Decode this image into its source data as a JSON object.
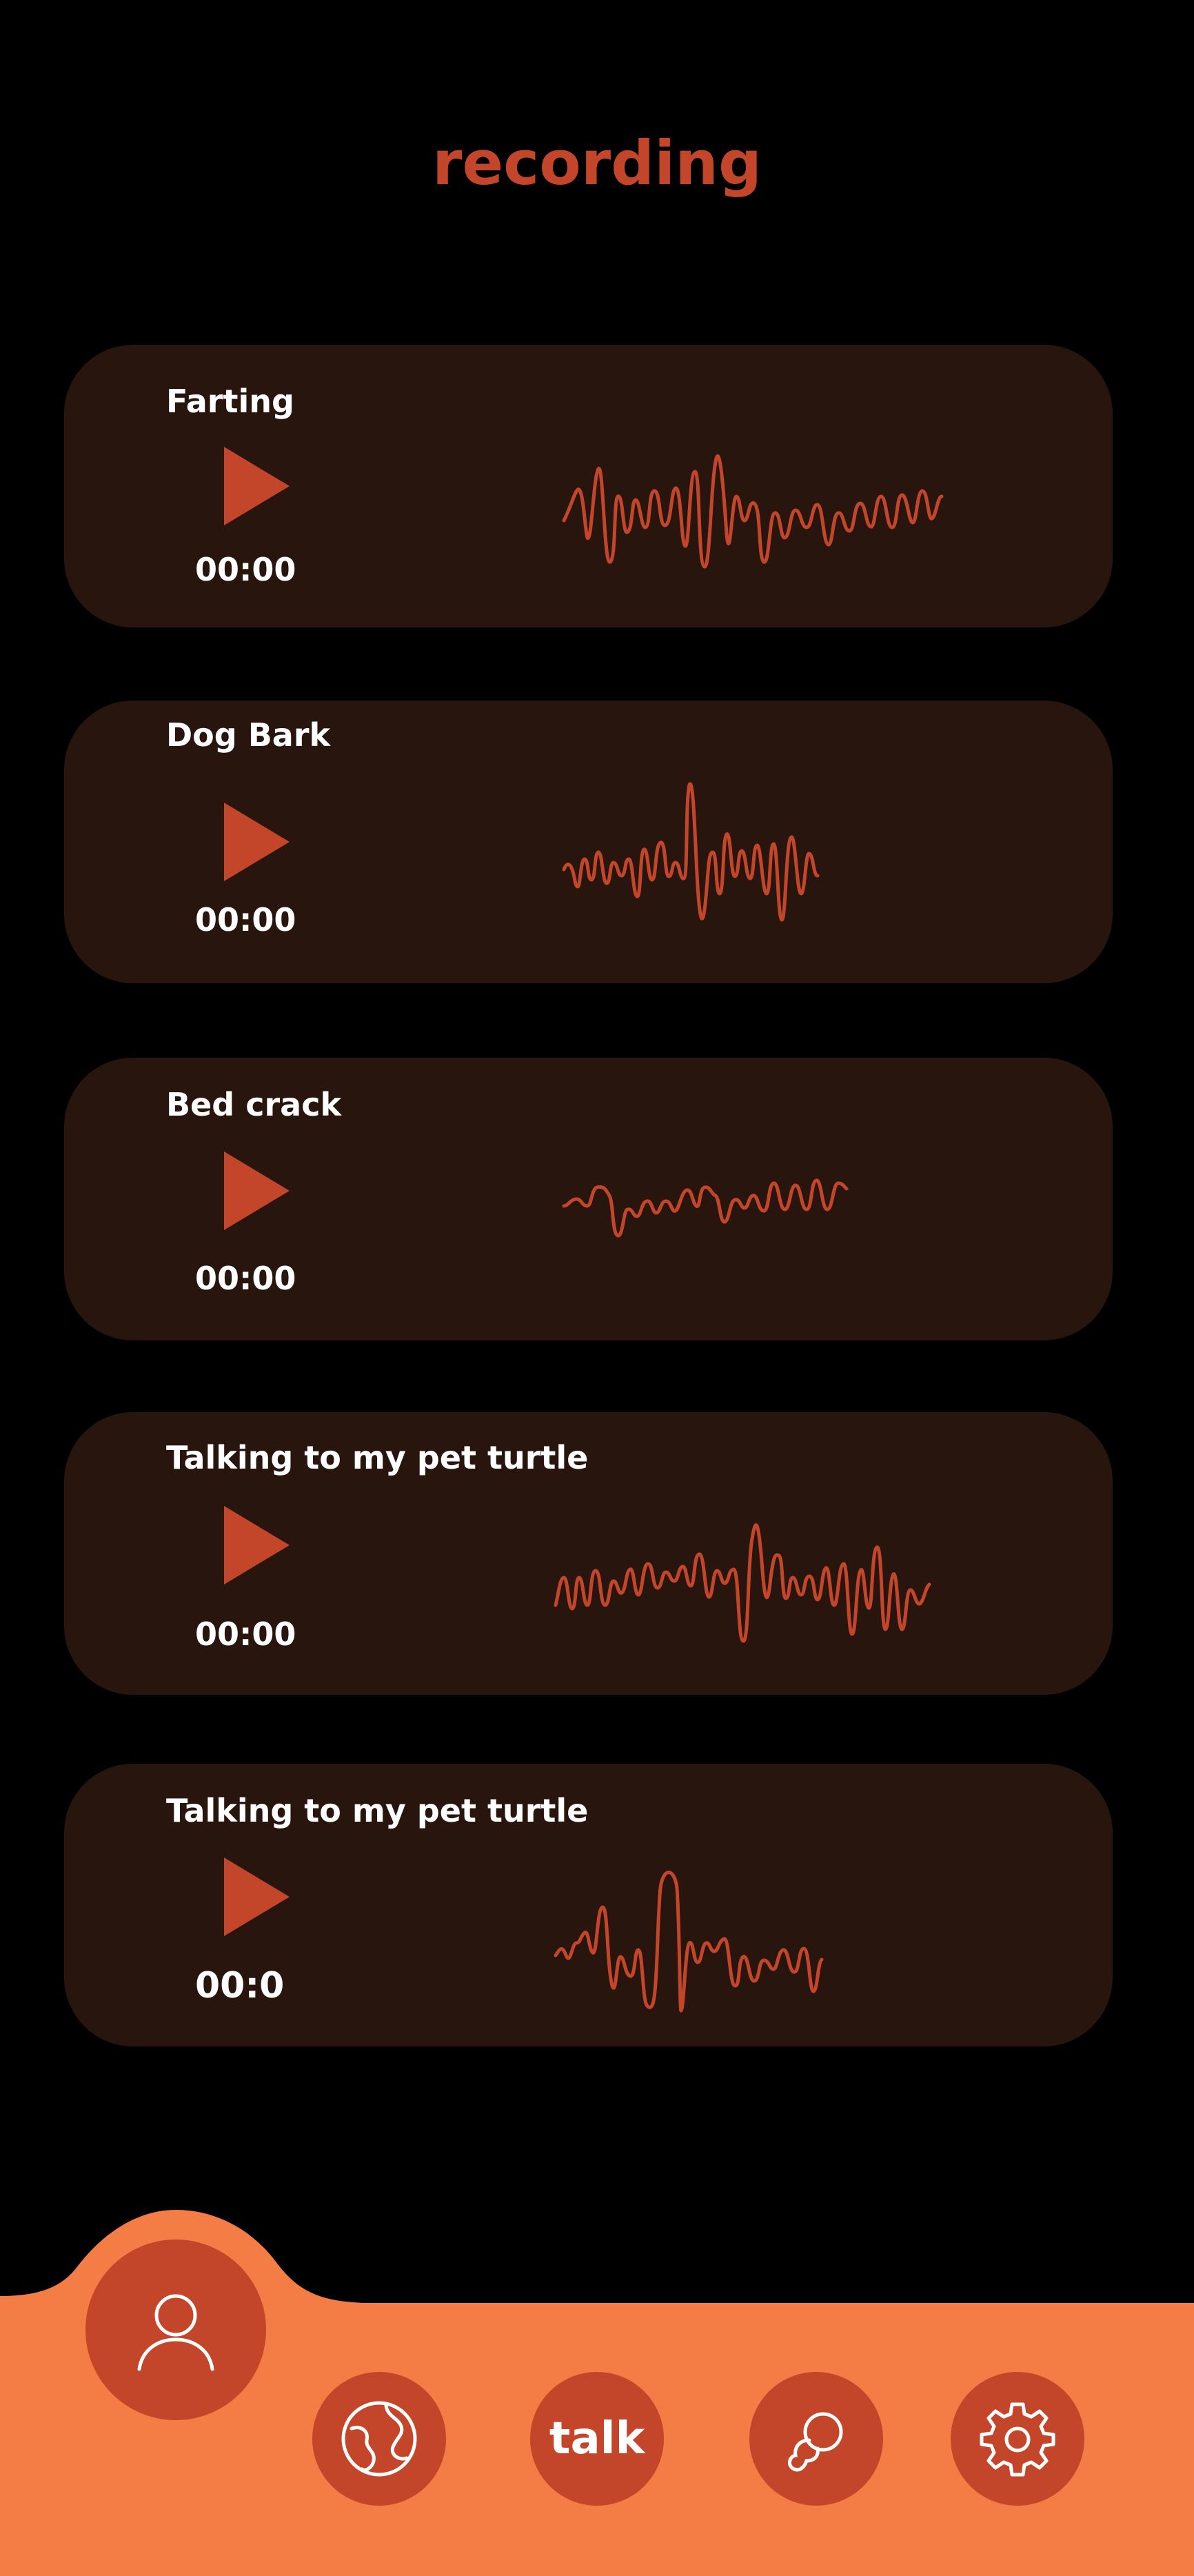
{
  "header": {
    "title": "recording"
  },
  "recordings": [
    {
      "name": "Farting",
      "time": "00:00"
    },
    {
      "name": "Dog Bark",
      "time": "00:00"
    },
    {
      "name": "Bed crack",
      "time": "00:00"
    },
    {
      "name": "Talking to my pet turtle",
      "time": "00:00"
    },
    {
      "name": "Talking to my pet turtle",
      "time": "00:0"
    }
  ],
  "nav": {
    "talk_label": "talk"
  },
  "colors": {
    "background": "#000000",
    "card": "#28160e",
    "accent": "#c4462a",
    "nav_bar": "#f47c45",
    "text": "#ffffff"
  },
  "icons": [
    "play-icon",
    "user-icon",
    "globe-icon",
    "pets-icon",
    "gear-icon"
  ]
}
